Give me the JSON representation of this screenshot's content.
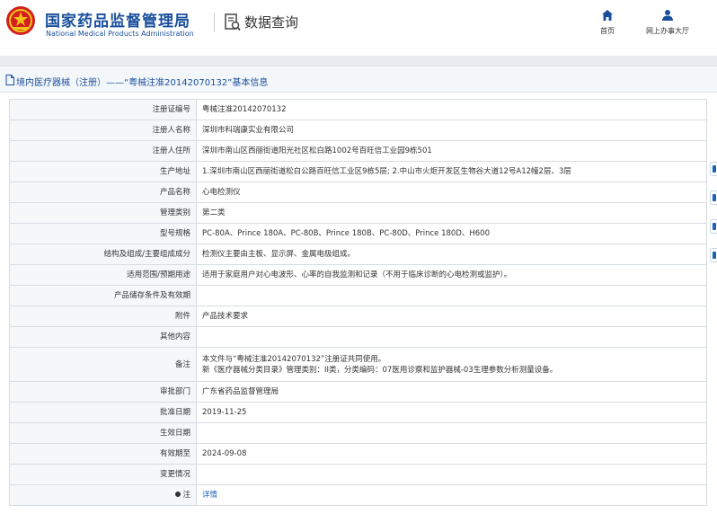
{
  "header": {
    "brand_cn": "国家药品监督管理局",
    "brand_en": "National Medical Products Administration",
    "query_title": "数据查询",
    "nav_home": "首页",
    "nav_hall": "网上办事大厅",
    "accent_color": "#1a4f9c",
    "emblem_icon": "national-emblem-icon",
    "home_icon": "home-icon",
    "user_icon": "user-icon"
  },
  "page": {
    "title": "境内医疗器械（注册）——“粤械注准20142070132”基本信息"
  },
  "rows": [
    {
      "label": "注册证编号",
      "value": "粤械注准20142070132"
    },
    {
      "label": "注册人名称",
      "value": "深圳市科瑞康实业有限公司"
    },
    {
      "label": "注册人住所",
      "value": "深圳市南山区西丽街道阳光社区松白路1002号百旺信工业园9栋501"
    },
    {
      "label": "生产地址",
      "value": "1.深圳市南山区西丽街道松白公路百旺信工业区9栋5层; 2.中山市火炬开发区生物谷大道12号A12幢2层、3层"
    },
    {
      "label": "产品名称",
      "value": "心电检测仪"
    },
    {
      "label": "管理类别",
      "value": "第二类"
    },
    {
      "label": "型号规格",
      "value": "PC-80A、Prince 180A、PC-80B、Prince 180B、PC-80D、Prince 180D、H600"
    },
    {
      "label": "结构及组成/主要组成成分",
      "value": "检测仪主要由主板、显示屏、金属电极组成。"
    },
    {
      "label": "适用范围/预期用途",
      "value": "适用于家庭用户对心电波形、心率的自我监测和记录（不用于临床诊断的心电检测或监护）。"
    },
    {
      "label": "产品储存条件及有效期",
      "value": ""
    },
    {
      "label": "附件",
      "value": "产品技术要求"
    },
    {
      "label": "其他内容",
      "value": ""
    },
    {
      "label": "备注",
      "value": "本文件与“粤械注准20142070132”注册证共同使用。",
      "value2": "新《医疗器械分类目录》管理类别：II类，分类编码：07医用诊察和监护器械-03生理参数分析测量设备。"
    },
    {
      "label": "审批部门",
      "value": "广东省药品监督管理局"
    },
    {
      "label": "批准日期",
      "value": "2019-11-25"
    },
    {
      "label": "生效日期",
      "value": ""
    },
    {
      "label": "有效期至",
      "value": "2024-09-08"
    },
    {
      "label": "变更情况",
      "value": ""
    }
  ],
  "note_row": {
    "label": "注",
    "link": "详情"
  }
}
